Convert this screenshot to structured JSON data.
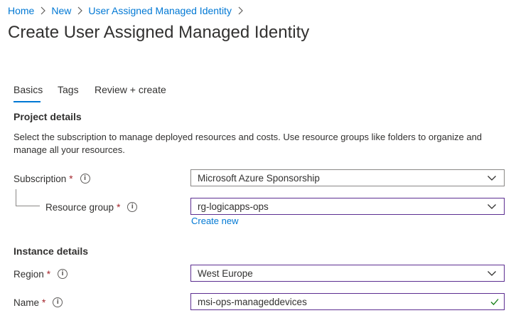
{
  "breadcrumb": {
    "items": [
      "Home",
      "New",
      "User Assigned Managed Identity"
    ]
  },
  "page": {
    "title": "Create User Assigned Managed Identity"
  },
  "tabs": [
    {
      "label": "Basics",
      "active": true
    },
    {
      "label": "Tags",
      "active": false
    },
    {
      "label": "Review + create",
      "active": false
    }
  ],
  "project": {
    "heading": "Project details",
    "description": "Select the subscription to manage deployed resources and costs. Use resource groups like folders to organize and manage all your resources.",
    "subscription": {
      "label": "Subscription",
      "required": "*",
      "value": "Microsoft Azure Sponsorship"
    },
    "resource_group": {
      "label": "Resource group",
      "required": "*",
      "value": "rg-logicapps-ops",
      "create_new": "Create new"
    }
  },
  "instance": {
    "heading": "Instance details",
    "region": {
      "label": "Region",
      "required": "*",
      "value": "West Europe"
    },
    "name": {
      "label": "Name",
      "required": "*",
      "value": "msi-ops-manageddevices"
    }
  },
  "colors": {
    "link": "#0078d4",
    "required": "#a4262c",
    "focus_border": "#5c2e91",
    "valid_check": "#107c10"
  }
}
